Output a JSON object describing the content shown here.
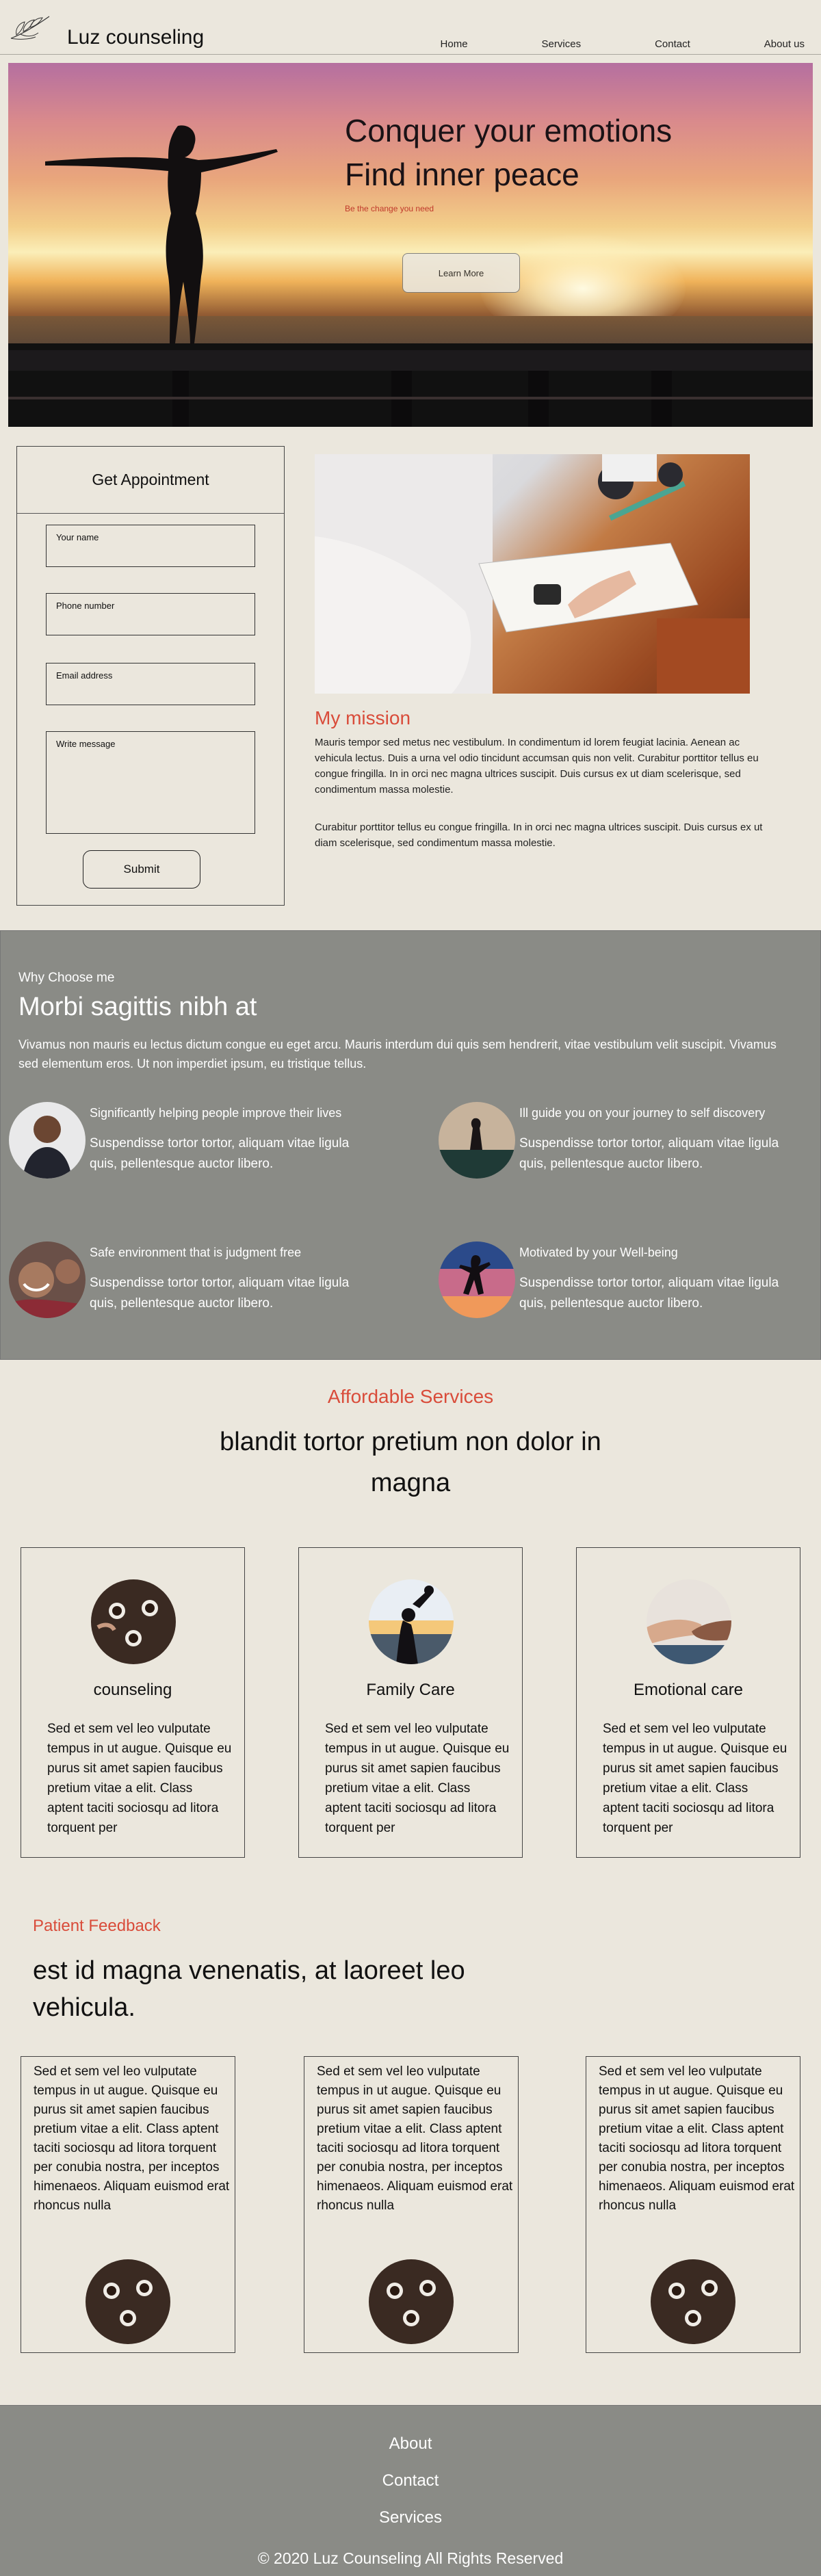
{
  "nav": {
    "brand": "Luz counseling",
    "links": [
      "Home",
      "Services",
      "Contact",
      "About us"
    ]
  },
  "hero": {
    "line1": "Conquer your emotions",
    "line2": "Find inner peace",
    "tagline": "Be the change you need",
    "button": "Learn More"
  },
  "appointment": {
    "title": "Get Appointment",
    "name_placeholder": "Your name",
    "phone_placeholder": "Phone number",
    "email_placeholder": "Email address",
    "message_placeholder": "Write message",
    "submit": "Submit"
  },
  "mission": {
    "title": "My mission",
    "p1": "Mauris tempor sed metus nec vestibulum. In condimentum id lorem feugiat lacinia. Aenean ac vehicula lectus. Duis a urna vel odio tincidunt accumsan quis non velit. Curabitur porttitor tellus eu congue fringilla. In in orci nec magna ultrices suscipit. Duis cursus ex ut diam scelerisque, sed condimentum massa molestie.",
    "p2": "Curabitur porttitor tellus eu congue fringilla. In in orci nec magna ultrices suscipit. Duis cursus ex ut diam scelerisque, sed condimentum massa molestie."
  },
  "why": {
    "small": "Why Choose me",
    "heading": "Morbi sagittis nibh at",
    "paragraph": "Vivamus non mauris eu lectus dictum congue eu eget arcu. Mauris interdum dui quis sem hendrerit, vitae vestibulum velit suscipit. Vivamus sed elementum eros. Ut non imperdiet ipsum, eu tristique tellus.",
    "features": [
      {
        "title": "Significantly helping people improve their lives",
        "desc": "Suspendisse tortor tortor, aliquam vitae ligula quis, pellentesque auctor libero."
      },
      {
        "title": "Ill guide you on your journey to self discovery",
        "desc": "Suspendisse tortor tortor, aliquam vitae ligula quis, pellentesque auctor libero."
      },
      {
        "title": "Safe environment that is judgment free",
        "desc": "Suspendisse tortor tortor, aliquam vitae ligula quis, pellentesque auctor libero."
      },
      {
        "title": "Motivated by your Well-being",
        "desc": "Suspendisse tortor tortor, aliquam vitae ligula quis, pellentesque auctor libero."
      }
    ]
  },
  "services": {
    "tag": "Affordable Services",
    "heading": "blandit tortor pretium non dolor in magna",
    "cards": [
      {
        "name": "counseling",
        "desc": "Sed et sem vel leo vulputate tempus in ut augue. Quisque eu purus sit amet sapien faucibus pretium vitae a elit. Class aptent taciti sociosqu ad litora torquent per"
      },
      {
        "name": "Family Care",
        "desc": "Sed et sem vel leo vulputate tempus in ut augue. Quisque eu purus sit amet sapien faucibus pretium vitae a elit. Class aptent taciti sociosqu ad litora torquent per"
      },
      {
        "name": "Emotional care",
        "desc": "Sed et sem vel leo vulputate tempus in ut augue. Quisque eu purus sit amet sapien faucibus pretium vitae a elit. Class aptent taciti sociosqu ad litora torquent per"
      }
    ]
  },
  "feedback": {
    "tag": "Patient Feedback",
    "heading": "est id magna venenatis, at laoreet leo vehicula.",
    "quotes": [
      "Sed et sem vel leo vulputate tempus in ut augue. Quisque eu purus sit amet sapien faucibus pretium vitae a elit. Class aptent taciti sociosqu ad litora torquent per conubia nostra, per inceptos himenaeos. Aliquam euismod erat rhoncus nulla",
      "Sed et sem vel leo vulputate tempus in ut augue. Quisque eu purus sit amet sapien faucibus pretium vitae a elit. Class aptent taciti sociosqu ad litora torquent per conubia nostra, per inceptos himenaeos. Aliquam euismod erat rhoncus nulla",
      "Sed et sem vel leo vulputate tempus in ut augue. Quisque eu purus sit amet sapien faucibus pretium vitae a elit. Class aptent taciti sociosqu ad litora torquent per conubia nostra, per inceptos himenaeos. Aliquam euismod erat rhoncus nulla"
    ]
  },
  "footer": {
    "links": [
      "About",
      "Contact",
      "Services"
    ],
    "copyright": "© 2020 Luz Counseling All Rights Reserved"
  },
  "colors": {
    "background": "#ebe7dd",
    "accent": "#d94c3a",
    "band": "#8a8b86"
  }
}
